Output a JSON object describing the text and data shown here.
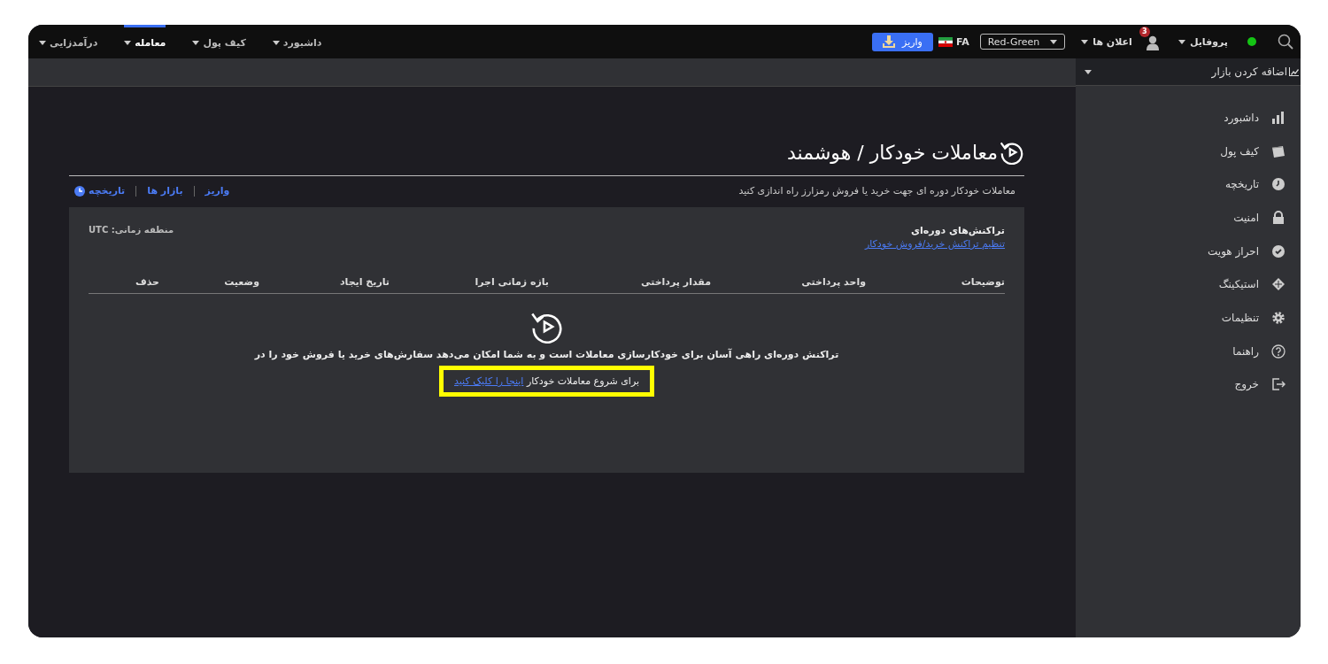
{
  "top_bar": {
    "online": true,
    "profile_menu": {
      "label": "پروفایل"
    },
    "notifications": {
      "label": "اعلان ها",
      "badge": "3"
    },
    "theme_select": {
      "value": "Red-Green"
    },
    "language": {
      "label": "FA"
    },
    "deposit_button": {
      "label": "واریز"
    },
    "nav": [
      {
        "label": "داشبورد",
        "selected": false
      },
      {
        "label": "کیف پول",
        "selected": false
      },
      {
        "label": "معامله",
        "selected": true
      },
      {
        "label": "درآمدزایی",
        "selected": false
      }
    ]
  },
  "sidebar": {
    "market_selector": {
      "label": "اضافه کردن بازار"
    },
    "items": [
      {
        "label": "داشبورد",
        "selected": false
      },
      {
        "label": "کیف پول",
        "selected": false
      },
      {
        "label": "تاریخچه",
        "selected": false
      },
      {
        "label": "امنیت",
        "selected": false
      },
      {
        "label": "احراز هویت",
        "selected": false
      },
      {
        "label": "استیکینگ",
        "selected": false
      },
      {
        "label": "تنظیمات",
        "selected": false
      },
      {
        "label": "راهنما",
        "selected": false
      },
      {
        "label": "خروج",
        "selected": false
      }
    ]
  },
  "page": {
    "title": "معاملات خودکار / هوشمند",
    "description": "معاملات خودکار دوره ای جهت خرید یا فروش رمزارز راه اندازی کنید",
    "links": [
      {
        "label": "واریز"
      },
      {
        "label": "بازار ها"
      },
      {
        "label": "تاریخچه"
      }
    ],
    "panel": {
      "title": "تراکنش‌های دوره‌ای",
      "setup_link": "تنظیم تراکنش خرید/فروش خودکار",
      "timezone": "منطقه زمانی: UTC",
      "columns": [
        "توضیحات",
        "واحد پرداختی",
        "مقدار پرداختی",
        "بازه زمانی اجرا",
        "تاریخ ایجاد",
        "وضعیت",
        "حذف"
      ],
      "empty_state": {
        "message": "تراکنش دوره‌ای راهی آسان برای خودکارسازی معاملات است و به شما امکان می‌دهد سفارش‌های خرید یا فروش خود را در",
        "prompt": "برای شروع معاملات خودکار",
        "prompt_link": "اینجا را کلیک کنید"
      }
    }
  }
}
